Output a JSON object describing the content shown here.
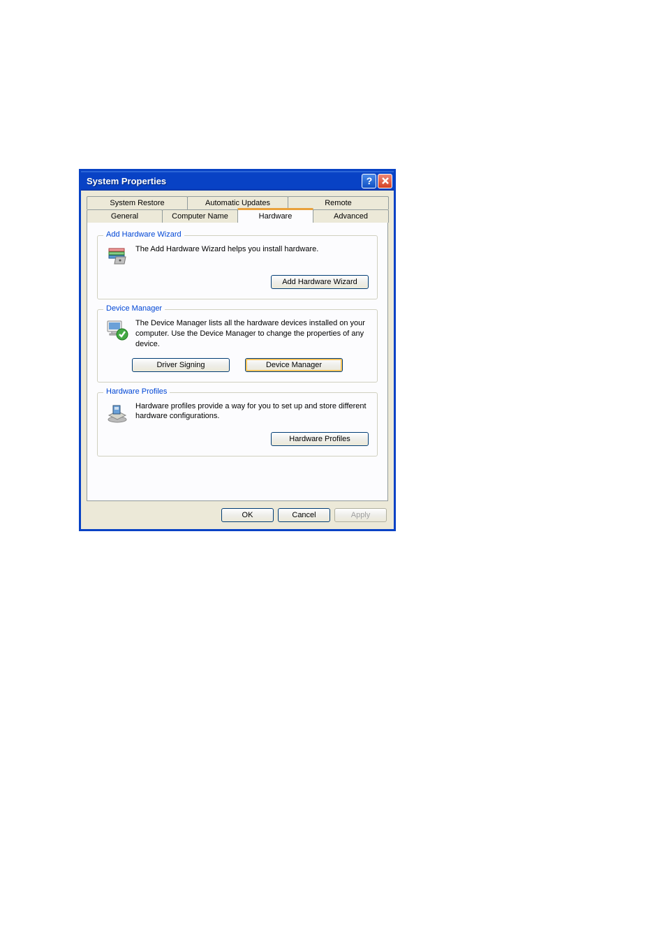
{
  "window": {
    "title": "System Properties"
  },
  "tabs": {
    "row1": [
      {
        "label": "System Restore"
      },
      {
        "label": "Automatic Updates"
      },
      {
        "label": "Remote"
      }
    ],
    "row2": [
      {
        "label": "General"
      },
      {
        "label": "Computer Name"
      },
      {
        "label": "Hardware"
      },
      {
        "label": "Advanced"
      }
    ]
  },
  "groups": {
    "add_hardware": {
      "title": "Add Hardware Wizard",
      "text": "The Add Hardware Wizard helps you install hardware.",
      "button": "Add Hardware Wizard"
    },
    "device_manager": {
      "title": "Device Manager",
      "text": "The Device Manager lists all the hardware devices installed on your computer. Use the Device Manager to change the properties of any device.",
      "driver_signing_button": "Driver Signing",
      "device_manager_button": "Device Manager"
    },
    "hardware_profiles": {
      "title": "Hardware Profiles",
      "text": "Hardware profiles provide a way for you to set up and store different hardware configurations.",
      "button": "Hardware Profiles"
    }
  },
  "dialog_buttons": {
    "ok": "OK",
    "cancel": "Cancel",
    "apply": "Apply"
  }
}
